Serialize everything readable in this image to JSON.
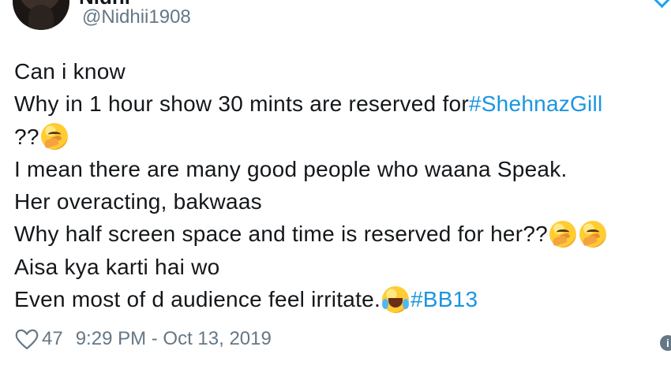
{
  "tweet": {
    "display_name": "Nidhi",
    "handle": "@Nidhii1908",
    "text": {
      "line1": "Can i know",
      "line2_prefix": "Why in 1 hour show 30 mints are reserved for ",
      "line2_hashtag": "#ShehnazGill",
      "line3": "??",
      "line4": "I mean there are many good people who waana Speak.",
      "line5": "Her overacting, bakwaas",
      "line6": "Why half screen space and time is reserved for her??",
      "line7": "Aisa kya karti hai wo",
      "line8_prefix": "Even most of d audience feel irritate.",
      "line8_hashtag": "#BB13"
    },
    "emojis": {
      "thinking": "thinking-face-emoji",
      "laughing": "face-with-tears-of-joy-emoji"
    },
    "likes": "47",
    "timestamp": "9:29 PM - Oct 13, 2019",
    "info_symbol": "i"
  },
  "colors": {
    "text": "#14171a",
    "secondary_text": "#657786",
    "hashtag": "#1b95e0",
    "background": "#ffffff"
  },
  "icons": {
    "like": "heart-icon",
    "info": "info-icon"
  }
}
